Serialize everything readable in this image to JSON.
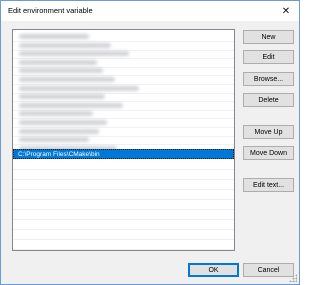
{
  "window": {
    "title": "Edit environment variable"
  },
  "list": {
    "selected_value": "C:\\Program Files\\CMake\\bin",
    "blurred_rows": 14,
    "empty_rows": 9
  },
  "buttons": {
    "new": "New",
    "edit": "Edit",
    "browse": "Browse...",
    "delete": "Delete",
    "move_up": "Move Up",
    "move_down": "Move Down",
    "edit_text": "Edit text..."
  },
  "footer": {
    "ok": "OK",
    "cancel": "Cancel"
  },
  "icons": {
    "close": "close-icon",
    "grip": "resize-grip-icon"
  }
}
